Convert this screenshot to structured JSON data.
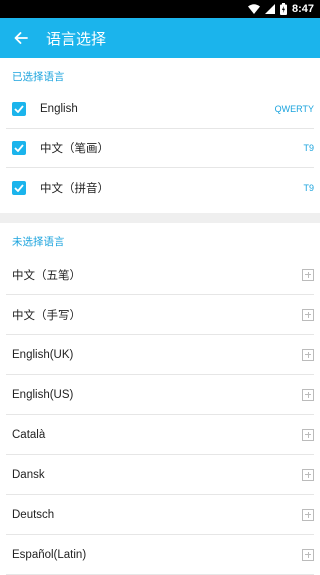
{
  "status_bar": {
    "time": "8:47",
    "icons": [
      "wifi-icon",
      "signal-icon",
      "battery-icon"
    ]
  },
  "app_bar": {
    "title": "语言选择",
    "background_color": "#1bb4ec"
  },
  "selected_section": {
    "header": "已选择语言",
    "items": [
      {
        "label": "English",
        "layout": "QWERTY",
        "checked": true
      },
      {
        "label": "中文（笔画）",
        "layout": "T9",
        "checked": true
      },
      {
        "label": "中文（拼音）",
        "layout": "T9",
        "checked": true
      }
    ]
  },
  "unselected_section": {
    "header": "未选择语言",
    "items": [
      {
        "label": "中文（五笔）"
      },
      {
        "label": "中文（手写）"
      },
      {
        "label": "English(UK)"
      },
      {
        "label": "English(US)"
      },
      {
        "label": "Català"
      },
      {
        "label": "Dansk"
      },
      {
        "label": "Deutsch"
      },
      {
        "label": "Español(Latin)"
      }
    ]
  },
  "colors": {
    "accent": "#1bb4ec",
    "section_header": "#1aa3dd"
  }
}
